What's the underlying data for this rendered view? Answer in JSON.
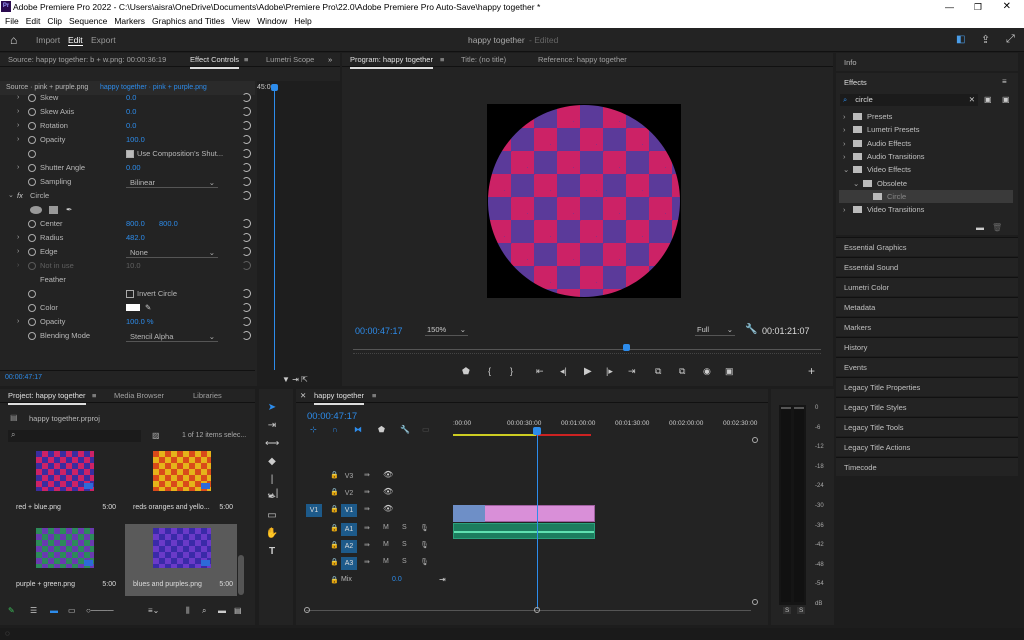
{
  "window": {
    "title": "Adobe Premiere Pro 2022 - C:\\Users\\aisra\\OneDrive\\Documents\\Adobe\\Premiere Pro\\22.0\\Adobe Premiere Pro Auto-Save\\happy together *",
    "app_badge": "Pr"
  },
  "menu": [
    "File",
    "Edit",
    "Clip",
    "Sequence",
    "Markers",
    "Graphics and Titles",
    "View",
    "Window",
    "Help"
  ],
  "header": {
    "tabs": [
      "Import",
      "Edit",
      "Export"
    ],
    "active_tab": "Edit",
    "project_name": "happy together",
    "status": "- Edited"
  },
  "effect_controls": {
    "tabs": [
      "Source: happy together: b + w.png: 00:00:36:19",
      "Effect Controls",
      "Lumetri Scope"
    ],
    "source_label": "Source · pink + purple.png",
    "clip_label": "happy together · pink + purple.png",
    "timeline_time": "45:0",
    "rows": [
      {
        "label": "Skew",
        "value": "0.0"
      },
      {
        "label": "Skew Axis",
        "value": "0.0"
      },
      {
        "label": "Rotation",
        "value": "0.0"
      },
      {
        "label": "Opacity",
        "value": "100.0"
      },
      {
        "label": "",
        "value": "Use Composition's Shut..."
      },
      {
        "label": "Shutter Angle",
        "value": "0.00"
      },
      {
        "label": "Sampling",
        "value": "Bilinear"
      }
    ],
    "circle_header": "Circle",
    "circle_rows": [
      {
        "label": "Center",
        "value": "800.0",
        "value2": "800.0"
      },
      {
        "label": "Radius",
        "value": "482.0"
      },
      {
        "label": "Edge",
        "value": "None"
      },
      {
        "label": "Not in use",
        "value": "10.0"
      },
      {
        "label": "Feather",
        "value": ""
      },
      {
        "label": "",
        "value": "Invert Circle"
      },
      {
        "label": "Color",
        "value": ""
      },
      {
        "label": "Opacity",
        "value": "100.0 %"
      },
      {
        "label": "Blending Mode",
        "value": "Stencil Alpha"
      }
    ],
    "footer_time": "00:00:47:17"
  },
  "program": {
    "tabs": [
      "Program: happy together",
      "Title: (no title)",
      "Reference: happy together"
    ],
    "timecode": "00:00:47:17",
    "zoom": "150%",
    "quality": "Full",
    "duration": "00:01:21:07"
  },
  "right_panel": {
    "info": "Info",
    "effects": "Effects",
    "search": "circle",
    "tree": [
      {
        "label": "Presets",
        "indent": 0
      },
      {
        "label": "Lumetri Presets",
        "indent": 0
      },
      {
        "label": "Audio Effects",
        "indent": 0
      },
      {
        "label": "Audio Transitions",
        "indent": 0
      },
      {
        "label": "Video Effects",
        "indent": 0
      },
      {
        "label": "Obsolete",
        "indent": 1
      },
      {
        "label": "Circle",
        "indent": 2
      },
      {
        "label": "Video Transitions",
        "indent": 0
      }
    ],
    "panels": [
      "Essential Graphics",
      "Essential Sound",
      "Lumetri Color",
      "Metadata",
      "Markers",
      "History",
      "Events",
      "Legacy Title Properties",
      "Legacy Title Styles",
      "Legacy Title Tools",
      "Legacy Title Actions",
      "Timecode"
    ]
  },
  "project": {
    "tabs": [
      "Project: happy together",
      "Media Browser",
      "Libraries"
    ],
    "file": "happy together.prproj",
    "count": "1 of 12 items selec...",
    "items": [
      {
        "name": "red + blue.png",
        "dur": "5:00"
      },
      {
        "name": "reds oranges and yello...",
        "dur": "5:00"
      },
      {
        "name": "purple + green.png",
        "dur": "5:00"
      },
      {
        "name": "blues and purples.png",
        "dur": "5:00"
      }
    ]
  },
  "timeline": {
    "tab": "happy together",
    "timecode": "00:00:47:17",
    "ruler": [
      ":00:00",
      "00:00:30:00",
      "00:01:00:00",
      "00:01:30:00",
      "00:02:00:00",
      "00:02:30:00"
    ],
    "tracks": [
      "V3",
      "V2",
      "V1",
      "A1",
      "A2",
      "A3"
    ],
    "source_patch": "V1",
    "mix_label": "Mix",
    "mix_value": "0.0"
  },
  "meter": {
    "ticks": [
      "0",
      "-6",
      "-12",
      "-18",
      "-24",
      "-30",
      "-36",
      "-42",
      "-48",
      "-54",
      "dB"
    ],
    "solo": [
      "S",
      "S"
    ]
  }
}
